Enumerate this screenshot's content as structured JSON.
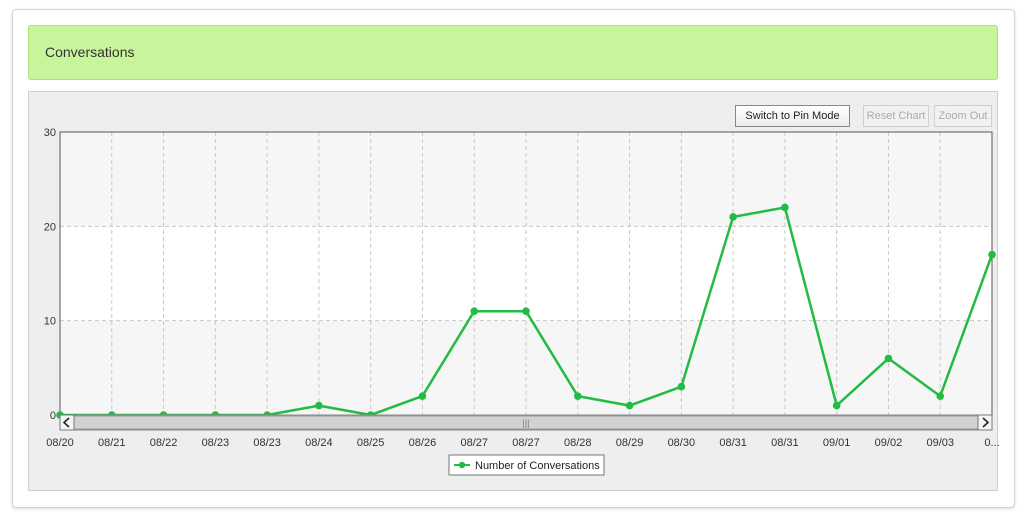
{
  "header": {
    "title": "Conversations"
  },
  "toolbar": {
    "pin_mode_label": "Switch to Pin Mode",
    "reset_label": "Reset Chart",
    "zoom_out_label": "Zoom Out"
  },
  "colors": {
    "series": "#22bb44",
    "header_bg": "#c8f59c"
  },
  "chart_data": {
    "type": "line",
    "x": [
      "08/20",
      "08/21",
      "08/22",
      "08/23",
      "08/23",
      "08/24",
      "08/25",
      "08/26",
      "08/27",
      "08/27",
      "08/28",
      "08/29",
      "08/30",
      "08/31",
      "08/31",
      "09/01",
      "09/02",
      "09/03",
      "0..."
    ],
    "series": [
      {
        "name": "Number of Conversations",
        "values": [
          0,
          0,
          0,
          0,
          0,
          1,
          0,
          2,
          11,
          11,
          2,
          1,
          3,
          21,
          22,
          1,
          6,
          2,
          17
        ]
      }
    ],
    "yticks": [
      0,
      10,
      20,
      30
    ],
    "ylim": [
      0,
      30
    ],
    "grid": true,
    "legend": "bottom-center",
    "scrollbar_grip": "|||"
  }
}
